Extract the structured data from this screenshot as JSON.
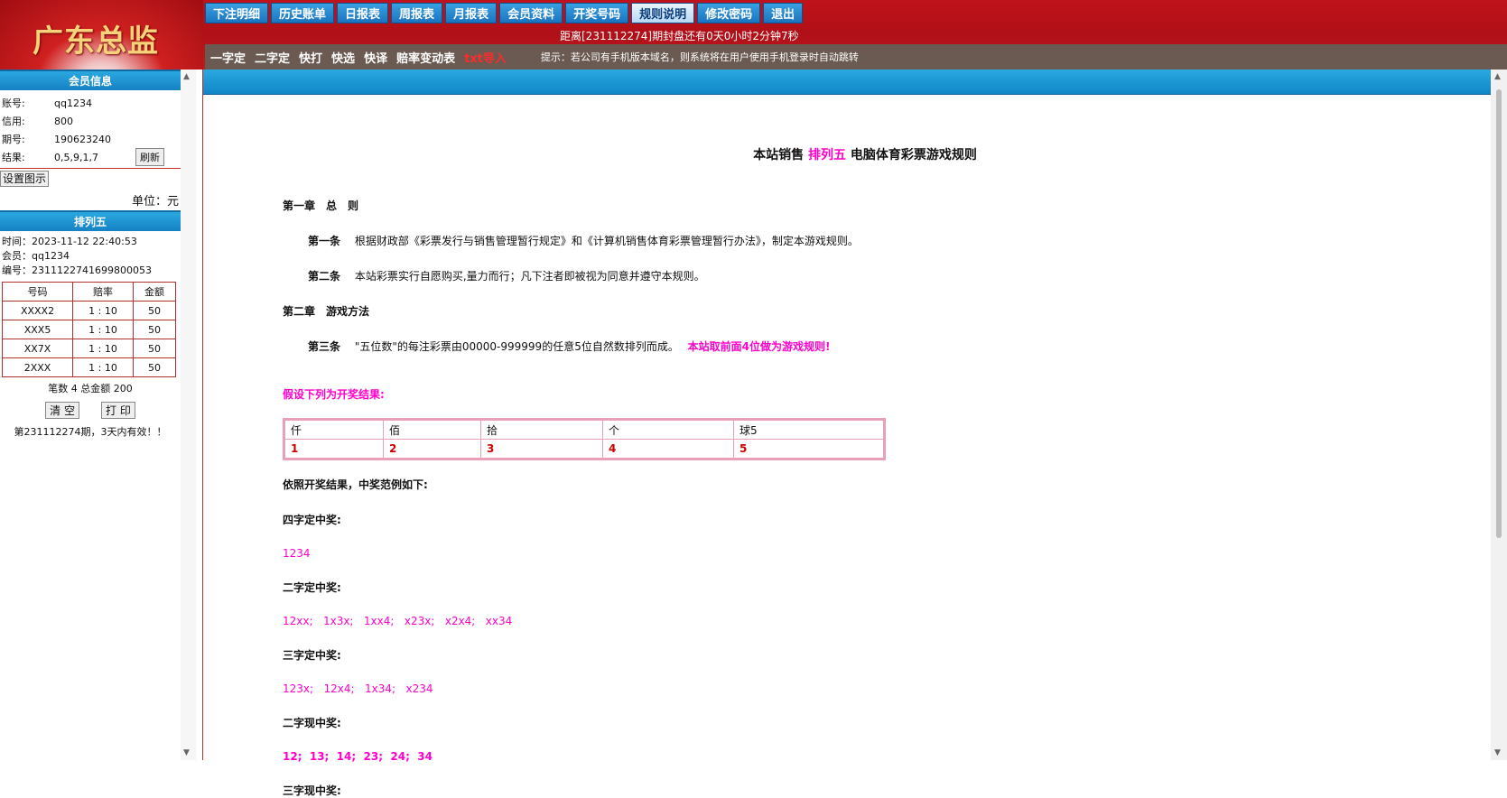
{
  "header": {
    "logo_text": "广东总监",
    "nav": [
      "下注明细",
      "历史账单",
      "日报表",
      "周报表",
      "月报表",
      "会员资料",
      "开奖号码",
      "规则说明",
      "修改密码",
      "退出"
    ],
    "active_nav": "规则说明",
    "countdown": "距离[231112274]期封盘还有0天0小时2分钟7秒",
    "sub_links": [
      "一字定",
      "二字定",
      "快打",
      "快选",
      "快译",
      "赔率变动表"
    ],
    "sub_red_link": "txt导入",
    "tip": "提示：若公司有手机版本域名，则系统将在用户使用手机登录时自动跳转"
  },
  "sidebar": {
    "member_header": "会员信息",
    "member": [
      {
        "label": "账号:",
        "value": "qq1234"
      },
      {
        "label": "信用:",
        "value": "800"
      },
      {
        "label": "期号:",
        "value": "190623240"
      },
      {
        "label": "结果:",
        "value": "0,5,9,1,7"
      }
    ],
    "refresh_label": "刷新",
    "settings_label": "设置图示",
    "unit": "单位：元",
    "bet_header": "排列五",
    "time": "时间：2023-11-12 22:40:53",
    "member_name": "会员：qq1234",
    "serial": "编号：2311122741699800053",
    "table_headers": [
      "号码",
      "赔率",
      "金额"
    ],
    "rows": [
      [
        "XXXX2",
        "1 : 10",
        "50"
      ],
      [
        "XXX5",
        "1 : 10",
        "50"
      ],
      [
        "XX7X",
        "1 : 10",
        "50"
      ],
      [
        "2XXX",
        "1 : 10",
        "50"
      ]
    ],
    "summary": "笔数 4 总金额 200",
    "clear_label": "清 空",
    "print_label": "打 印",
    "valid_note": "第231112274期，3天内有效！！"
  },
  "rules": {
    "title_prefix": "本站销售",
    "title_highlight": "排列五",
    "title_suffix": "电脑体育彩票游戏规则",
    "ch1": "第一章　总　则",
    "art1_label": "第一条",
    "art1_text": "根据财政部《彩票发行与销售管理暂行规定》和《计算机销售体育彩票管理暂行办法》，制定本游戏规则。",
    "art2_label": "第二条",
    "art2_text": "本站彩票实行自愿购买,量力而行；凡下注者即被视为同意并遵守本规则。",
    "ch2": "第二章　游戏方法",
    "art3_label": "第三条",
    "art3_text": "\"五位数\"的每注彩票由00000-999999的任意5位自然数排列而成。",
    "art3_highlight": "本站取前面4位做为游戏规则!",
    "assume": "假设下列为开奖结果:",
    "result_headers": [
      "仟",
      "佰",
      "拾",
      "个",
      "球5"
    ],
    "result_values": [
      "1",
      "2",
      "3",
      "4",
      "5"
    ],
    "examples_intro": "依照开奖结果，中奖范例如下:",
    "s4_title": "四字定中奖:",
    "s4_val": "1234",
    "s2_title": "二字定中奖:",
    "s2_val": "12xx;   1x3x;   1xx4;   x23x;   x2x4;   xx34",
    "s3_title": "三字定中奖:",
    "s3_val": "123x;   12x4;   1x34;   x234",
    "s2x_title": "二字现中奖:",
    "s2x_val": "12;  13;  14;  23;  24;  34",
    "s3x_title": "三字现中奖:"
  }
}
